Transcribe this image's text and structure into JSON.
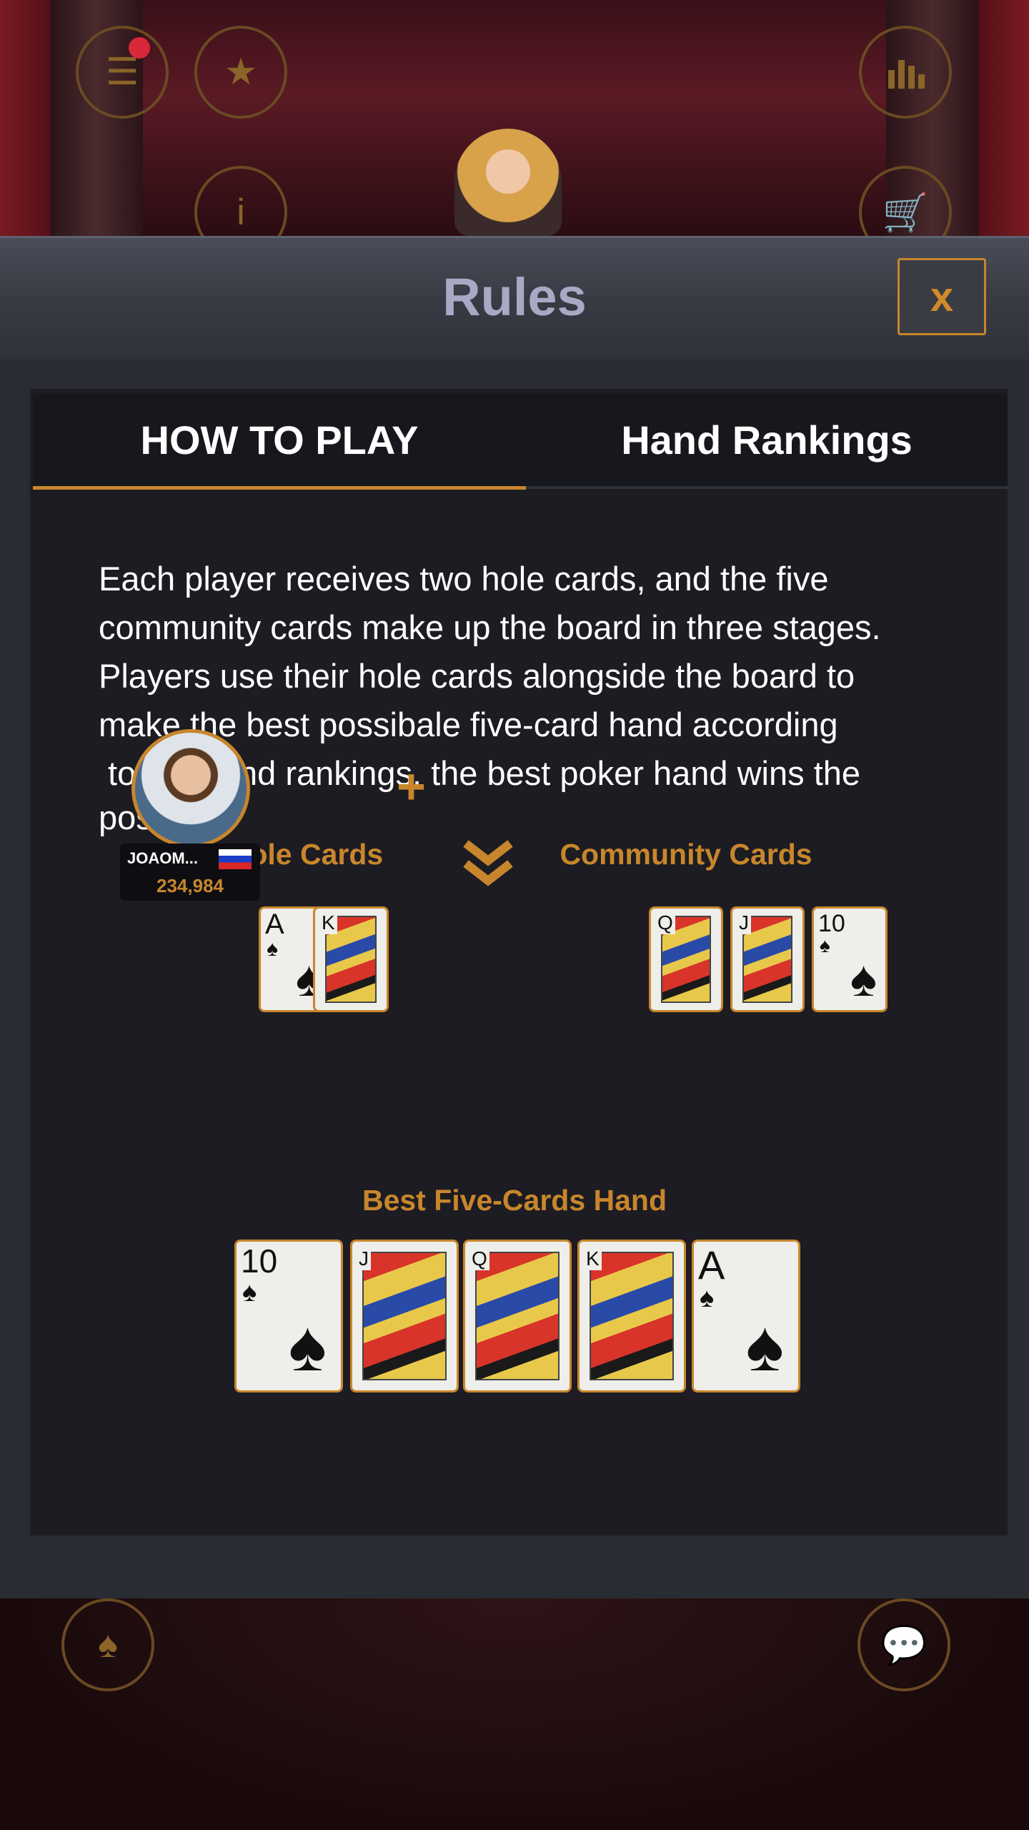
{
  "hud": {
    "menu_icon": "menu-icon",
    "bookmark_icon": "star-bookmark-icon",
    "stats_icon": "bar-chart-icon",
    "info_icon": "info-icon",
    "cart_icon": "shopping-cart-icon",
    "cards_icon": "playing-cards-icon",
    "chat_icon": "chat-icon"
  },
  "modal": {
    "title": "Rules",
    "close_label": "x"
  },
  "tabs": [
    {
      "label": "HOW TO PLAY",
      "active": true
    },
    {
      "label": "Hand Rankings",
      "active": false
    }
  ],
  "content": {
    "line1": "Each player receives two hole cards, and the five",
    "line2": "community cards make up the board in three stages.",
    "line3": "Players use their hole cards alongside the board to",
    "line4": "make the best possibale five-card hand according",
    "line5": " to the hand rankings. the best poker hand wins the",
    "line6": "post.",
    "hole_cards_label": "Hole Cards",
    "community_cards_label": "Community Cards",
    "best_hand_label": "Best Five-Cards Hand",
    "plus": "+"
  },
  "player": {
    "name": "JOAOM...",
    "chips": "234,984",
    "flag": "russia-flag"
  },
  "hole_cards": [
    {
      "rank": "A",
      "suit": "♠"
    },
    {
      "rank": "K",
      "suit": "♠"
    }
  ],
  "community_cards": [
    {
      "rank": "Q",
      "suit": "♠"
    },
    {
      "rank": "J",
      "suit": "♠"
    },
    {
      "rank": "10",
      "suit": "♠"
    }
  ],
  "best_hand": [
    {
      "rank": "10",
      "suit": "♠"
    },
    {
      "rank": "J",
      "suit": "♠"
    },
    {
      "rank": "Q",
      "suit": "♠"
    },
    {
      "rank": "K",
      "suit": "♠"
    },
    {
      "rank": "A",
      "suit": "♠"
    }
  ],
  "colors": {
    "accent": "#c8862c",
    "panel": "#1c1c22",
    "title": "#a8a9c4"
  }
}
